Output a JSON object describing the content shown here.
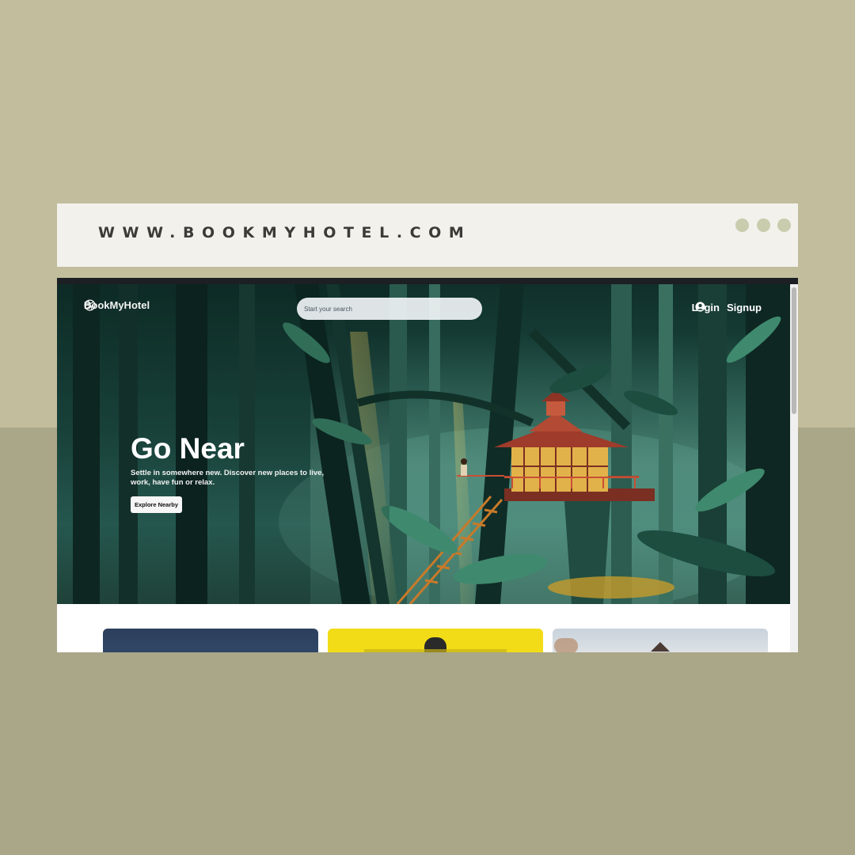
{
  "url_bar": {
    "url": "WWW.BOOKMYHOTEL.COM",
    "dot_color": "#c9ccad"
  },
  "header": {
    "brand": "BookMyHotel",
    "brand_icon": "dribbble-ball-icon",
    "search_placeholder": "Start your search",
    "login": "Login",
    "signup": "Signup",
    "user_icon": "user-circle-icon"
  },
  "hero": {
    "title": "Go Near",
    "subtitle": "Settle in somewhere new. Discover new places to live, work, have fun or relax.",
    "cta": "Explore Nearby"
  },
  "colors": {
    "background_top": "#c2bd9c",
    "background_bottom": "#aaa688",
    "url_bar": "#f2f1ec",
    "hero_dark": "#10302b",
    "treehouse_roof": "#9e3b2b",
    "treehouse_light": "#e8b94a"
  },
  "cards": [
    {
      "name": "night-sky-card",
      "color": "#2c3f5c"
    },
    {
      "name": "yellow-card",
      "color": "#f2dc18"
    },
    {
      "name": "house-card",
      "color": "#d9dde0"
    }
  ]
}
